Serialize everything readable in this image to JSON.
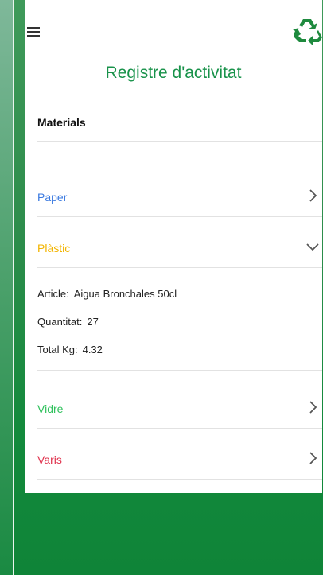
{
  "header": {
    "title": "Registre d'activitat",
    "menu_icon": "menu-icon",
    "logo_icon": "recycle-icon"
  },
  "section": {
    "title": "Materials"
  },
  "materials": [
    {
      "label": "Paper",
      "color": "#3b7ae0",
      "icon": "chevron-right-icon"
    },
    {
      "label": "Plàstic",
      "color": "#f2b400",
      "icon": "chevron-down-icon"
    },
    {
      "label": "Vidre",
      "color": "#2fc15c",
      "icon": "chevron-right-icon"
    },
    {
      "label": "Varis",
      "color": "#e0324d",
      "icon": "chevron-right-icon"
    }
  ],
  "plastic_details": {
    "article_label": "Article:",
    "article_value": "Aigua Bronchales 50cl",
    "quantity_label": "Quantitat:",
    "quantity_value": "27",
    "total_label": "Total Kg:",
    "total_value": "4.32"
  },
  "colors": {
    "accent": "#18924a",
    "background_green": "#138a3c"
  }
}
